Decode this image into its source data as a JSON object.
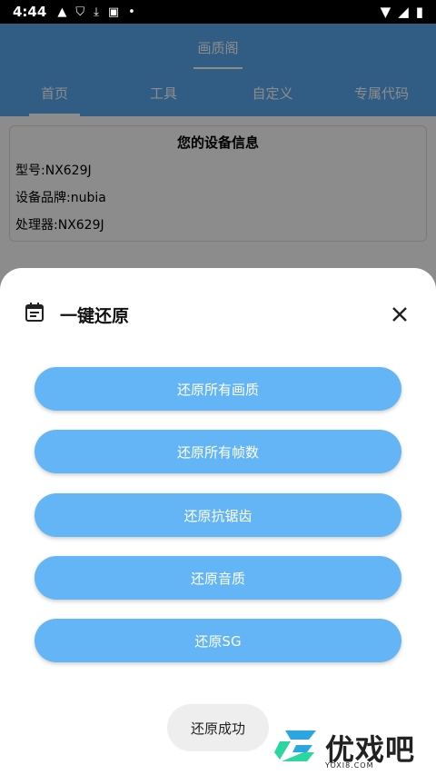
{
  "status_bar": {
    "time": "4:44"
  },
  "app_title": "画质阁",
  "tabs": [
    "首页",
    "工具",
    "自定义",
    "专属代码"
  ],
  "device_info": {
    "title": "您的设备信息",
    "model": "型号:NX629J",
    "brand": "设备品牌:nubia",
    "processor": "处理器:NX629J"
  },
  "sheet": {
    "title": "一键还原",
    "buttons": [
      "还原所有画质",
      "还原所有帧数",
      "还原抗锯齿",
      "还原音质",
      "还原SG"
    ]
  },
  "toast": "还原成功",
  "watermark": {
    "text": "优戏吧",
    "sub": "YOXI8.COM"
  },
  "colors": {
    "primary": "#5aa9f0",
    "button": "#64b5f6"
  }
}
